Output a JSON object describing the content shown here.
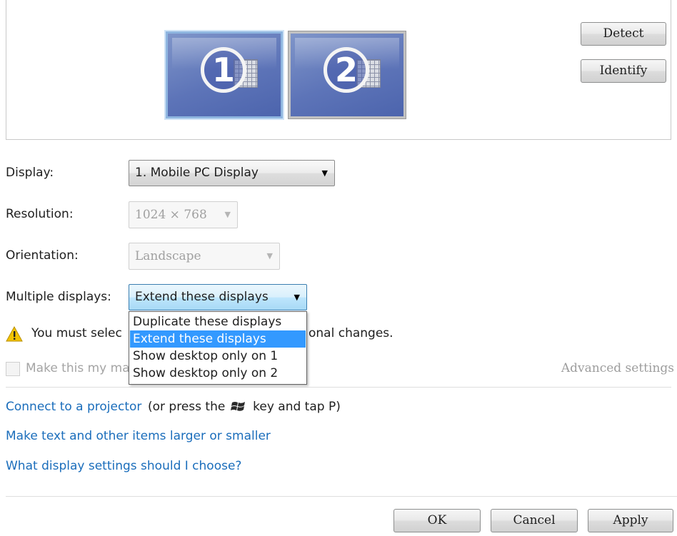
{
  "preview": {
    "monitors": [
      {
        "number": "1",
        "selected": true
      },
      {
        "number": "2",
        "selected": false
      }
    ],
    "detect_label": "Detect",
    "identify_label": "Identify"
  },
  "form": {
    "display_label": "Display:",
    "display_value": "1. Mobile PC Display",
    "resolution_label": "Resolution:",
    "resolution_value": "1024 × 768",
    "orientation_label": "Orientation:",
    "orientation_value": "Landscape",
    "multiple_label": "Multiple displays:",
    "multiple_value": "Extend these displays",
    "multiple_options": [
      "Duplicate these displays",
      "Extend these displays",
      "Show desktop only on 1",
      "Show desktop only on 2"
    ],
    "multiple_selected_index": 1
  },
  "warning": {
    "text_start": "You must selec",
    "text_end": "onal changes."
  },
  "main_display": {
    "label": "Make this my ma",
    "checked": false
  },
  "advanced_label": "Advanced settings",
  "links": {
    "projector": "Connect to a projector",
    "projector_suffix_a": "(or press the",
    "projector_suffix_b": "key and tap P)",
    "text_size": "Make text and other items larger or smaller",
    "help": "What display settings should I choose?"
  },
  "footer": {
    "ok_label": "OK",
    "cancel_label": "Cancel",
    "apply_label": "Apply"
  },
  "colors": {
    "link": "#1a6dbb",
    "selection": "#3399ff",
    "warning": "#f2c200"
  }
}
